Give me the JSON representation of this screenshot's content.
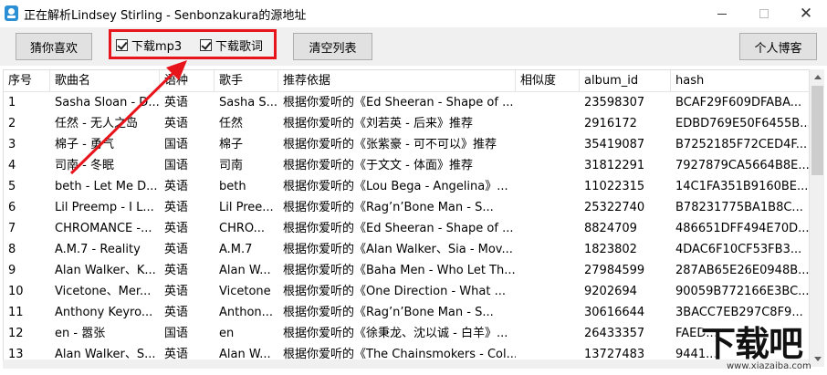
{
  "window": {
    "title": "正在解析Lindsey Stirling - Senbonzakura的源地址",
    "minimize_label": "",
    "maximize_label": "",
    "close_label": "✕"
  },
  "toolbar": {
    "guess_button": "猜你喜欢",
    "download_mp3": "下载mp3",
    "download_lyrics": "下载歌词",
    "clear_button": "清空列表",
    "blog_button": "个人博客",
    "download_mp3_checked": true,
    "download_lyrics_checked": true,
    "highlight_color": "#e8141b"
  },
  "table": {
    "columns": [
      "序号",
      "歌曲名",
      "语种",
      "歌手",
      "推荐依据",
      "相似度",
      "album_id",
      "hash"
    ],
    "rows": [
      [
        "1",
        "Sasha Sloan - D...",
        "英语",
        "Sasha S...",
        "根据你爱听的《Ed Sheeran - Shape of ...",
        "",
        "23598307",
        "BCAF29F609DFABA..."
      ],
      [
        "2",
        "任然 - 无人之岛",
        "英语",
        "任然",
        "根据你爱听的《刘若英 - 后来》推荐",
        "",
        "2916172",
        "EDBD769E50F6455B..."
      ],
      [
        "3",
        "棉子 - 勇气",
        "国语",
        "棉子",
        "根据你爱听的《张紫豪 - 可不可以》推荐",
        "",
        "35419087",
        "B7252185F72CED4F..."
      ],
      [
        "4",
        "司南 - 冬眠",
        "国语",
        "司南",
        "根据你爱听的《于文文 - 体面》推荐",
        "",
        "31812291",
        "7927879CA5664B8E..."
      ],
      [
        "5",
        "beth - Let Me D...",
        "英语",
        "beth",
        "根据你爱听的《Lou Bega - Angelina》...",
        "",
        "11022315",
        "14C1FA351B9160BE..."
      ],
      [
        "6",
        "Lil Preemp - I L...",
        "英语",
        "Lil Pree...",
        "根据你爱听的《Rag’n’Bone Man - S...",
        "",
        "25322740",
        "B78231775BA1B8C..."
      ],
      [
        "7",
        "CHROMANCE -...",
        "英语",
        "CHRO...",
        "根据你爱听的《Ed Sheeran - Shape of ...",
        "",
        "8824709",
        "486651DFF494E70D..."
      ],
      [
        "8",
        "A.M.7 - Reality",
        "英语",
        "A.M.7",
        "根据你爱听的《Alan Walker、Sia - Mov...",
        "",
        "1823802",
        "4DAC6F10CF53FB3..."
      ],
      [
        "9",
        "Alan Walker、K...",
        "英语",
        "Alan W...",
        "根据你爱听的《Baha Men - Who Let Th...",
        "",
        "27984599",
        "287AB65E26E0948B..."
      ],
      [
        "10",
        "Vicetone、Mer...",
        "英语",
        "Vicetone",
        "根据你爱听的《One Direction - What ...",
        "",
        "9202694",
        "90059B772166E3BC..."
      ],
      [
        "11",
        "Anthony Keyro...",
        "英语",
        "Anthon...",
        "根据你爱听的《Rag’n’Bone Man - S...",
        "",
        "30616644",
        "3BACC7EB297C8F9..."
      ],
      [
        "12",
        "en - 嚣张",
        "国语",
        "en",
        "根据你爱听的《徐秉龙、沈以诚 - 白羊》...",
        "",
        "26433357",
        "FAED..."
      ],
      [
        "13",
        "Alan Walker、S...",
        "英语",
        "Alan W...",
        "根据你爱听的《The Chainsmokers - Col...",
        "",
        "13727483",
        "9441..."
      ]
    ]
  },
  "watermark": {
    "logo_text": "下载吧",
    "url": "www.xiazaiba.com"
  }
}
